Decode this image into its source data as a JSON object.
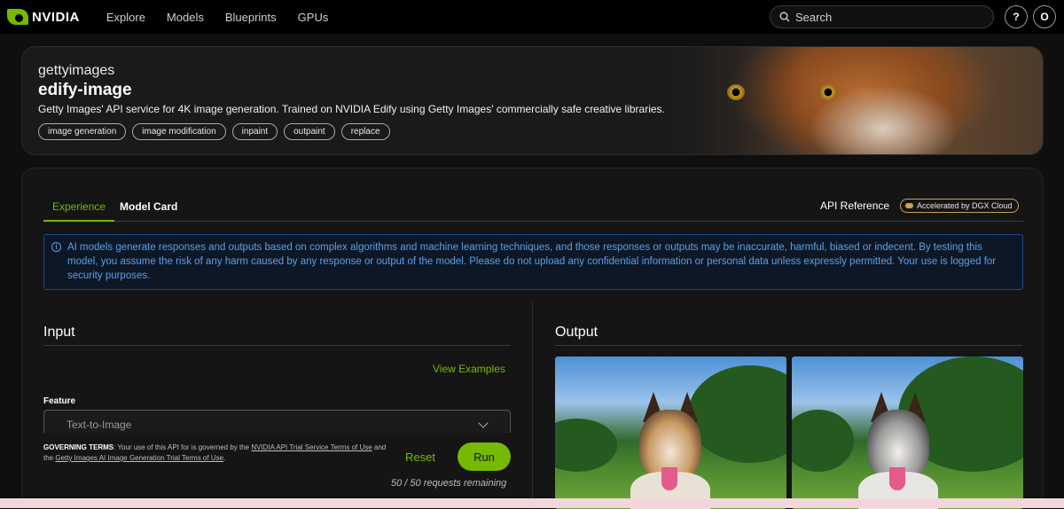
{
  "nav": {
    "brand": "NVIDIA",
    "links": [
      "Explore",
      "Models",
      "Blueprints",
      "GPUs"
    ],
    "search_placeholder": "Search",
    "help_label": "?",
    "avatar_label": "O"
  },
  "hero": {
    "brand": "gettyimages",
    "title": "edify-image",
    "description": "Getty Images' API service for 4K image generation. Trained on NVIDIA Edify using Getty Images' commercially safe creative libraries.",
    "tags": [
      "image generation",
      "image modification",
      "inpaint",
      "outpaint",
      "replace"
    ]
  },
  "tabs": {
    "experience": "Experience",
    "model_card": "Model Card",
    "api_reference": "API Reference",
    "badge": "Accelerated by DGX Cloud"
  },
  "notice": {
    "icon": "info-icon",
    "text": "AI models generate responses and outputs based on complex algorithms and machine learning techniques, and those responses or outputs may be inaccurate, harmful, biased or indecent. By testing this model, you assume the risk of any harm caused by any response or output of the model. Please do not upload any confidential information or personal data unless expressly permitted. Your use is logged for security purposes."
  },
  "input": {
    "title": "Input",
    "view_examples": "View Examples",
    "feature_label": "Feature",
    "feature_value": "Text-to-Image",
    "gov_terms_label": "GOVERNING TERMS",
    "gov_terms_text1": ": Your use of this API for is governed by the ",
    "gov_terms_link1": "NVIDIA API Trial Service Terms of Use",
    "gov_terms_text2": " and the ",
    "gov_terms_link2": "Getty Images AI Image Generation Trial Terms of Use",
    "gov_terms_text3": ".",
    "reset_label": "Reset",
    "run_label": "Run",
    "remaining": "50 / 50 requests remaining"
  },
  "output": {
    "title": "Output"
  },
  "colors": {
    "accent": "#76b900",
    "notice": "#5aa0ea"
  }
}
